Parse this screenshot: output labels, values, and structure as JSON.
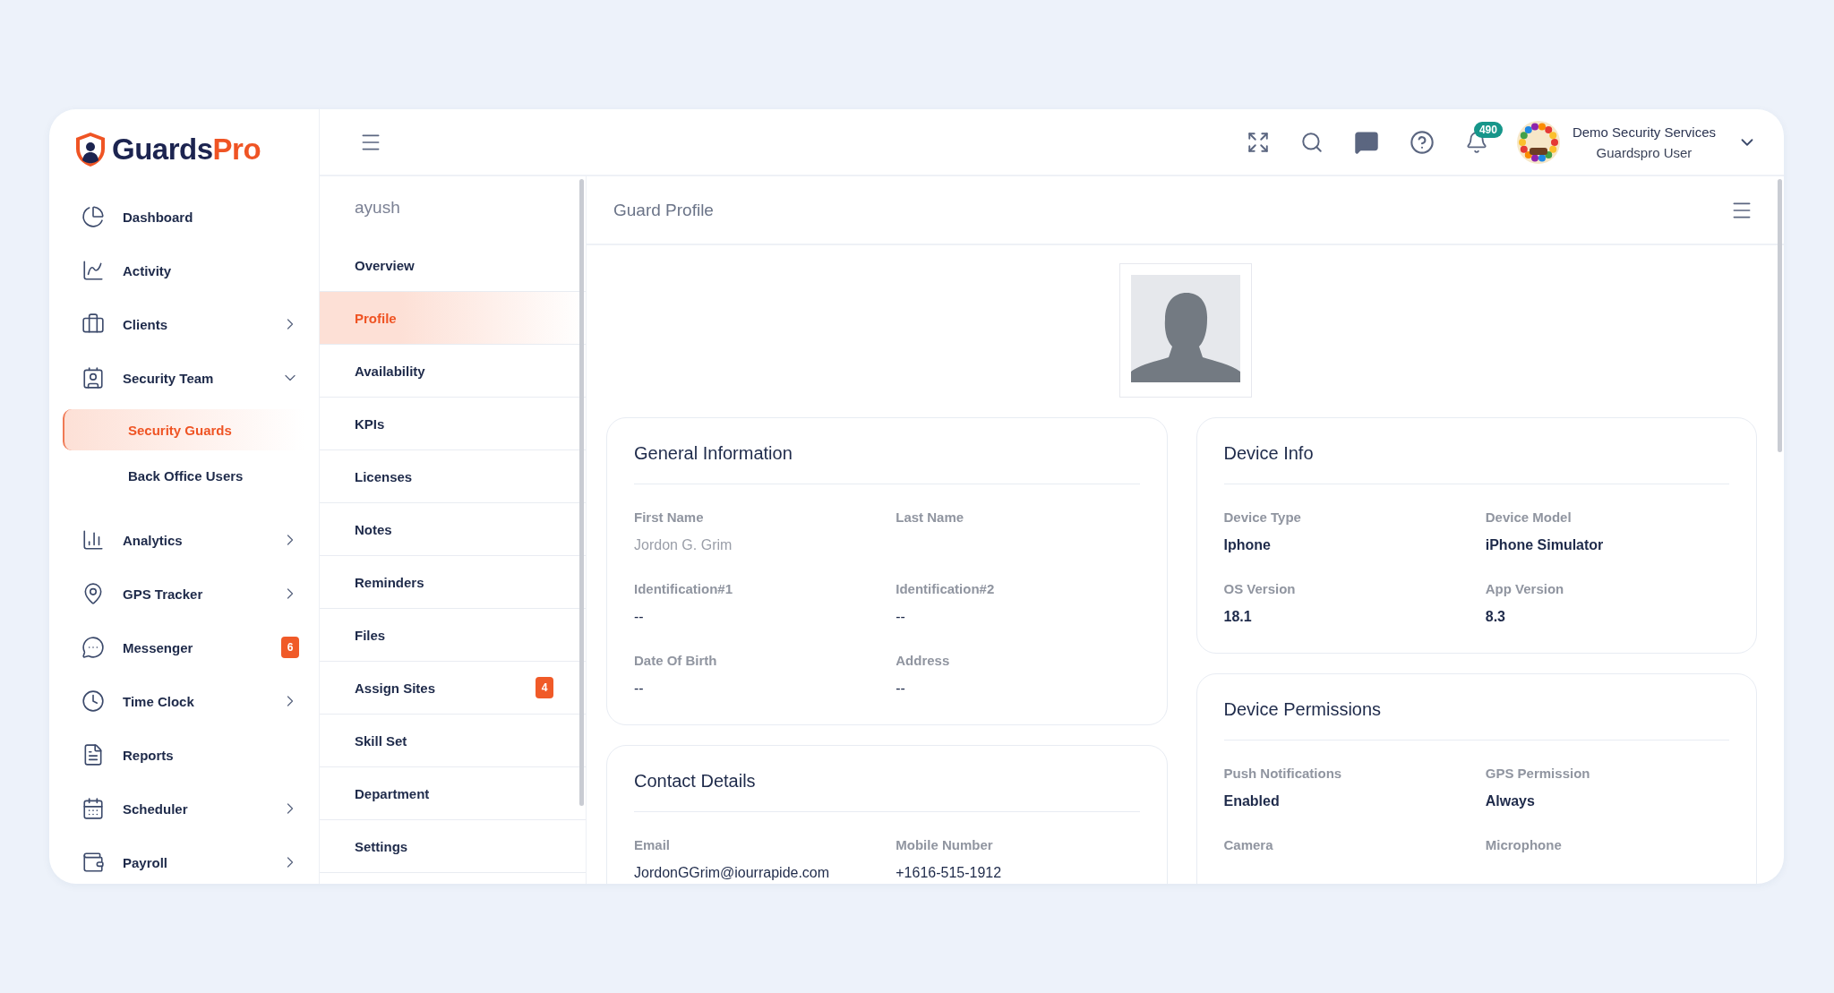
{
  "logo": {
    "parts": [
      "Guards",
      "Pro"
    ]
  },
  "sidebar": {
    "items": [
      {
        "label": "Dashboard",
        "selected": false
      },
      {
        "label": "Activity",
        "selected": false
      },
      {
        "label": "Clients",
        "selected": false,
        "expanded": false
      },
      {
        "label": "Security Team",
        "selected": false,
        "expanded": true,
        "children": [
          {
            "label": "Security Guards",
            "selected": true
          },
          {
            "label": "Back Office Users",
            "selected": false
          }
        ]
      },
      {
        "label": "Analytics",
        "selected": false,
        "expanded": false
      },
      {
        "label": "GPS Tracker",
        "selected": false,
        "expanded": false
      },
      {
        "label": "Messenger",
        "selected": false,
        "badge": "6"
      },
      {
        "label": "Time Clock",
        "selected": false,
        "expanded": false
      },
      {
        "label": "Reports",
        "selected": false
      },
      {
        "label": "Scheduler",
        "selected": false,
        "expanded": false
      },
      {
        "label": "Payroll",
        "selected": false,
        "expanded": false
      }
    ]
  },
  "header": {
    "notifications": "490",
    "user": {
      "name": "Demo Security Services",
      "role": "Guardspro User"
    }
  },
  "subnav": {
    "title": "ayush",
    "items": [
      {
        "label": "Overview",
        "selected": false
      },
      {
        "label": "Profile",
        "selected": true
      },
      {
        "label": "Availability",
        "selected": false
      },
      {
        "label": "KPIs",
        "selected": false
      },
      {
        "label": "Licenses",
        "selected": false
      },
      {
        "label": "Notes",
        "selected": false
      },
      {
        "label": "Reminders",
        "selected": false
      },
      {
        "label": "Files",
        "selected": false
      },
      {
        "label": "Assign Sites",
        "selected": false,
        "badge": "4"
      },
      {
        "label": "Skill Set",
        "selected": false
      },
      {
        "label": "Department",
        "selected": false
      },
      {
        "label": "Settings",
        "selected": false
      }
    ]
  },
  "page": {
    "title": "Guard Profile",
    "columns": [
      [
        {
          "title": "General Information",
          "fields": [
            {
              "label": "First Name",
              "value": "Jordon G. Grim",
              "kind": "muted"
            },
            {
              "label": "Last Name"
            },
            {
              "label": "Identification#1",
              "value": "--",
              "kind": "regular"
            },
            {
              "label": "Identification#2",
              "value": "--",
              "kind": "regular"
            },
            {
              "label": "Date Of Birth",
              "value": "--",
              "kind": "regular"
            },
            {
              "label": "Address",
              "value": "--",
              "kind": "regular"
            }
          ]
        },
        {
          "title": "Contact Details",
          "fields": [
            {
              "label": "Email",
              "value": "JordonGGrim@iourrapide.com",
              "kind": "regular"
            },
            {
              "label": "Mobile Number",
              "value": "+1616-515-1912",
              "kind": "regular"
            }
          ]
        }
      ],
      [
        {
          "title": "Device Info",
          "fields": [
            {
              "label": "Device Type",
              "value": "Iphone",
              "kind": "strong"
            },
            {
              "label": "Device Model",
              "value": "iPhone Simulator",
              "kind": "strong"
            },
            {
              "label": "OS Version",
              "value": "18.1",
              "kind": "strong"
            },
            {
              "label": "App Version",
              "value": "8.3",
              "kind": "strong"
            }
          ]
        },
        {
          "title": "Device Permissions",
          "fields": [
            {
              "label": "Push Notifications",
              "value": "Enabled",
              "kind": "strong"
            },
            {
              "label": "GPS Permission",
              "value": "Always",
              "kind": "strong"
            },
            {
              "label": "Camera"
            },
            {
              "label": "Microphone"
            }
          ]
        }
      ]
    ]
  }
}
